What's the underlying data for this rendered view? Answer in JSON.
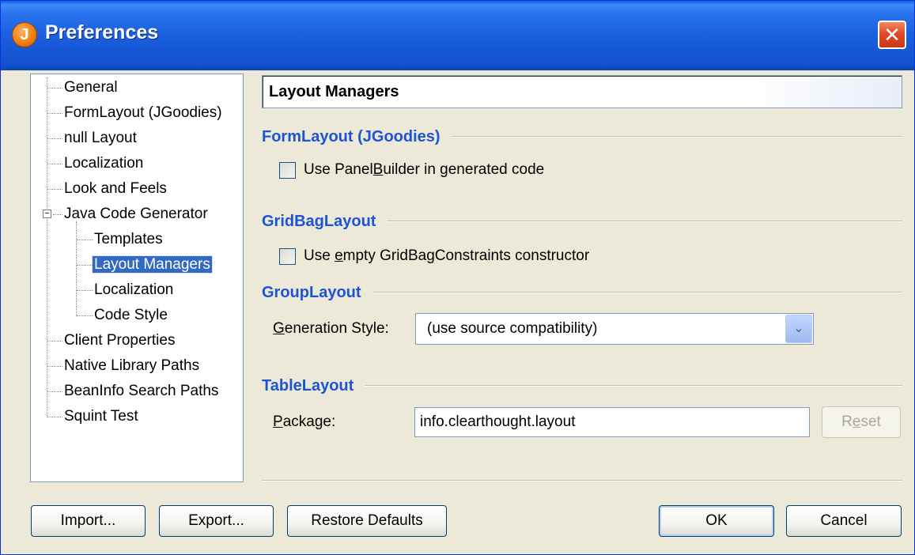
{
  "window": {
    "title": "Preferences",
    "icon_letter": "J",
    "close_glyph": "✕"
  },
  "tree": {
    "items": [
      {
        "label": "General"
      },
      {
        "label": "FormLayout (JGoodies)"
      },
      {
        "label": "null Layout"
      },
      {
        "label": "Localization"
      },
      {
        "label": "Look and Feels"
      },
      {
        "label": "Java Code Generator",
        "expanded": true
      },
      {
        "label": "Templates"
      },
      {
        "label": "Layout Managers",
        "selected": true
      },
      {
        "label": "Localization"
      },
      {
        "label": "Code Style"
      },
      {
        "label": "Client Properties"
      },
      {
        "label": "Native Library Paths"
      },
      {
        "label": "BeanInfo Search Paths"
      },
      {
        "label": "Squint Test"
      }
    ],
    "expander_glyph": "−"
  },
  "panel": {
    "heading": "Layout Managers",
    "formlayout": {
      "title": "FormLayout (JGoodies)",
      "checkbox_pre": "Use Panel",
      "checkbox_mn": "B",
      "checkbox_post": "uilder in generated code",
      "checked": false
    },
    "gridbag": {
      "title": "GridBagLayout",
      "checkbox_pre": "Use ",
      "checkbox_mn": "e",
      "checkbox_post": "mpty GridBagConstraints constructor",
      "checked": false
    },
    "grouplayout": {
      "title": "GroupLayout",
      "label_mn": "G",
      "label_rest": "eneration Style:",
      "selected": "(use source compatibility)",
      "arrow": "⌄"
    },
    "tablelayout": {
      "title": "TableLayout",
      "label_mn": "P",
      "label_rest": "ackage:",
      "value": "info.clearthought.layout",
      "reset_pre": "R",
      "reset_mn": "e",
      "reset_post": "set"
    }
  },
  "buttons": {
    "import": "Import...",
    "export": "Export...",
    "restore": "Restore Defaults",
    "ok": "OK",
    "cancel": "Cancel"
  }
}
